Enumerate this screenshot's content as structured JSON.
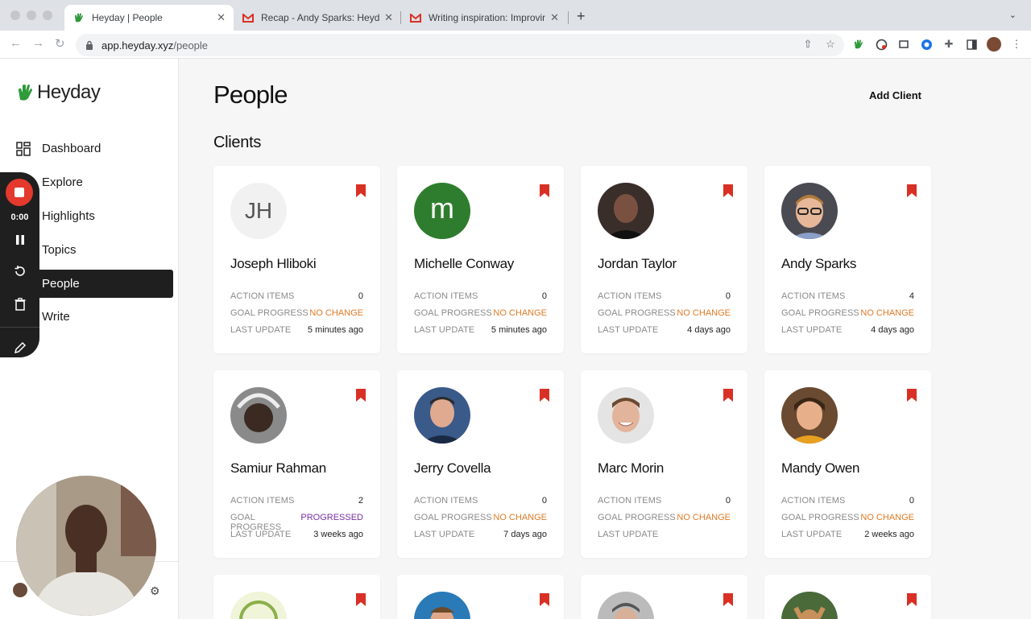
{
  "browser": {
    "tabs": [
      {
        "title": "Heyday | People",
        "active": true
      },
      {
        "title": "Recap - Andy Sparks: Heyday",
        "active": false
      },
      {
        "title": "Writing inspiration: Improving",
        "active": false
      }
    ],
    "url_host": "app.heyday.xyz",
    "url_path": "/people"
  },
  "sidebar": {
    "logo": "Heyday",
    "items": [
      {
        "label": "Dashboard"
      },
      {
        "label": "Explore"
      },
      {
        "label": "Highlights"
      },
      {
        "label": "Topics"
      },
      {
        "label": "People",
        "active": true
      },
      {
        "label": "Write"
      }
    ]
  },
  "recorder": {
    "time": "0:00"
  },
  "main": {
    "title": "People",
    "add_client_label": "Add Client",
    "section_title": "Clients"
  },
  "labels": {
    "action_items": "ACTION ITEMS",
    "goal_progress": "GOAL PROGRESS",
    "last_update": "LAST UPDATE"
  },
  "clients": [
    {
      "name": "Joseph Hliboki",
      "initials": "JH",
      "action_items": "0",
      "goal_progress": "NO CHANGE",
      "last_update": "5 minutes ago"
    },
    {
      "name": "Michelle Conway",
      "initials": "m",
      "action_items": "0",
      "goal_progress": "NO CHANGE",
      "last_update": "5 minutes ago"
    },
    {
      "name": "Jordan Taylor",
      "action_items": "0",
      "goal_progress": "NO CHANGE",
      "last_update": "4 days ago"
    },
    {
      "name": "Andy Sparks",
      "action_items": "4",
      "goal_progress": "NO CHANGE",
      "last_update": "4 days ago"
    },
    {
      "name": "Samiur Rahman",
      "action_items": "2",
      "goal_progress": "PROGRESSED",
      "last_update": "3 weeks ago"
    },
    {
      "name": "Jerry Covella",
      "action_items": "0",
      "goal_progress": "NO CHANGE",
      "last_update": "7 days ago"
    },
    {
      "name": "Marc Morin",
      "action_items": "0",
      "goal_progress": "NO CHANGE",
      "last_update": ""
    },
    {
      "name": "Mandy Owen",
      "action_items": "0",
      "goal_progress": "NO CHANGE",
      "last_update": "2 weeks ago"
    }
  ],
  "colors": {
    "accent_green": "#2e9a3a",
    "bookmark_red": "#d93025",
    "no_change_orange": "#e07a26",
    "progressed_purple": "#7a2fa8"
  }
}
